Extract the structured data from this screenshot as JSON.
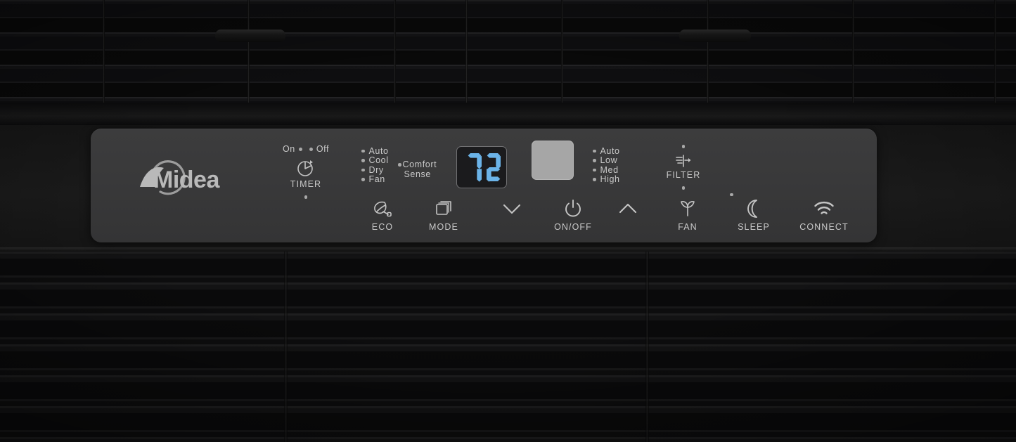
{
  "device": {
    "brand": "Midea",
    "panel_type": "air-conditioner-control-panel"
  },
  "display": {
    "value": "72",
    "segment_color": "#6bb3e8",
    "background_color": "#1b1b1d"
  },
  "timer": {
    "on_label": "On",
    "off_label": "Off",
    "label": "TIMER",
    "icon": "clock-icon"
  },
  "mode_indicators": [
    {
      "label": "Auto"
    },
    {
      "label": "Cool"
    },
    {
      "label": "Dry"
    },
    {
      "label": "Fan"
    }
  ],
  "comfort_sense": {
    "line1": "Comfort",
    "line2": "Sense"
  },
  "fan_indicators": [
    {
      "label": "Auto"
    },
    {
      "label": "Low"
    },
    {
      "label": "Med"
    },
    {
      "label": "High"
    }
  ],
  "filter": {
    "label": "FILTER",
    "icon": "filter-flow-icon"
  },
  "buttons": [
    {
      "id": "eco",
      "label": "ECO",
      "icon": "leaf-eco-icon"
    },
    {
      "id": "mode",
      "label": "MODE",
      "icon": "stacked-squares-icon"
    },
    {
      "id": "down",
      "label": "",
      "icon": "chevron-down-icon"
    },
    {
      "id": "onoff",
      "label": "ON/OFF",
      "icon": "power-icon"
    },
    {
      "id": "up",
      "label": "",
      "icon": "chevron-up-icon"
    },
    {
      "id": "fan",
      "label": "FAN",
      "icon": "fan-blade-icon"
    },
    {
      "id": "sleep",
      "label": "SLEEP",
      "icon": "crescent-moon-icon"
    },
    {
      "id": "connect",
      "label": "CONNECT",
      "icon": "wifi-icon"
    }
  ],
  "colors": {
    "panel_face": "#3a3a3b",
    "label_text": "#c9c9c9",
    "led_off": "#a8a8a8",
    "blank_key": "#a6a6a6",
    "background": "#111111"
  }
}
